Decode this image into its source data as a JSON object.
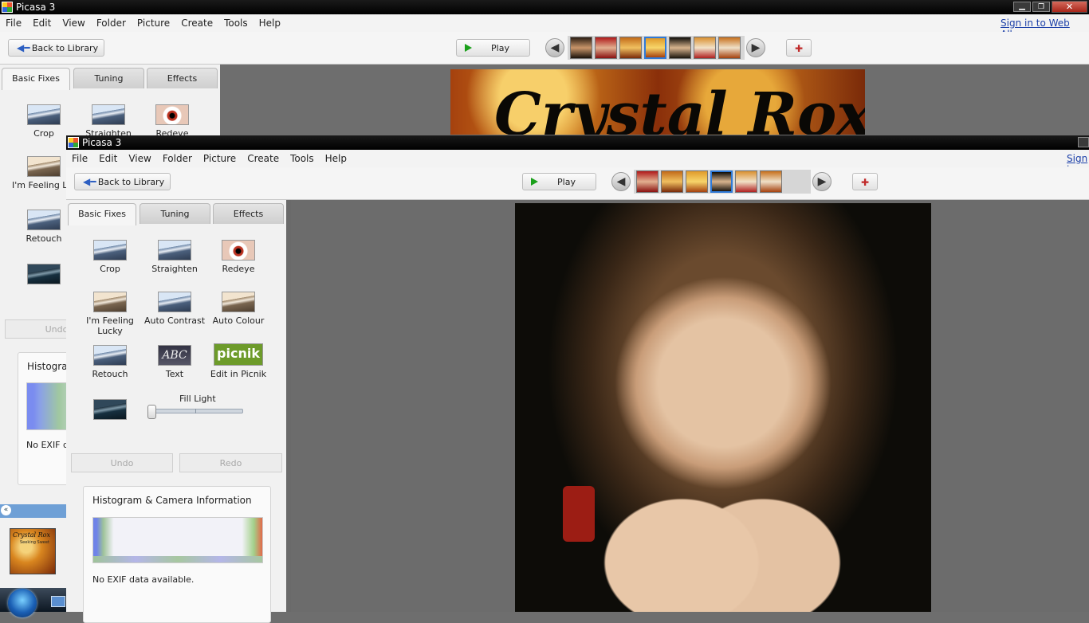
{
  "back_window": {
    "title": "Picasa 3",
    "menu": [
      "File",
      "Edit",
      "View",
      "Folder",
      "Picture",
      "Create",
      "Tools",
      "Help"
    ],
    "sign_in_link": "Sign in to Web Albums",
    "back_label": "Back to Library",
    "play_label": "Play",
    "tabs": [
      "Basic Fixes",
      "Tuning",
      "Effects"
    ],
    "tools": [
      "Crop",
      "Straighten",
      "Redeye",
      "I'm Feeling Luc",
      "Retouch"
    ],
    "undo_label": "Undo",
    "histogram_title": "Histogran",
    "exif_text": "No EXIF da",
    "banner_text": "Crystal Rox"
  },
  "front_window": {
    "title": "Picasa 3",
    "menu": [
      "File",
      "Edit",
      "View",
      "Folder",
      "Picture",
      "Create",
      "Tools",
      "Help"
    ],
    "sign_in_link": "Sign in",
    "back_label": "Back to Library",
    "play_label": "Play",
    "tabs": [
      "Basic Fixes",
      "Tuning",
      "Effects"
    ],
    "tools": [
      {
        "label": "Crop",
        "icon": "crop-icon"
      },
      {
        "label": "Straighten",
        "icon": "straighten-icon"
      },
      {
        "label": "Redeye",
        "icon": "redeye-icon"
      },
      {
        "label": "I'm Feeling Lucky",
        "icon": "feeling-lucky-icon"
      },
      {
        "label": "Auto Contrast",
        "icon": "auto-contrast-icon"
      },
      {
        "label": "Auto Colour",
        "icon": "auto-colour-icon"
      },
      {
        "label": "Retouch",
        "icon": "retouch-icon"
      },
      {
        "label": "Text",
        "icon": "text-icon"
      },
      {
        "label": "Edit in Picnik",
        "icon": "picnik-icon"
      }
    ],
    "text_icon_glyph": "ABC",
    "picnik_icon_glyph": "picnik",
    "fill_light_label": "Fill Light",
    "fill_light_value": 0,
    "undo_label": "Undo",
    "redo_label": "Redo",
    "histogram_title": "Histogram & Camera Information",
    "exif_text": "No EXIF data available."
  },
  "album_thumb_text": [
    "Crystal Rox",
    "Seeking Sweet"
  ]
}
